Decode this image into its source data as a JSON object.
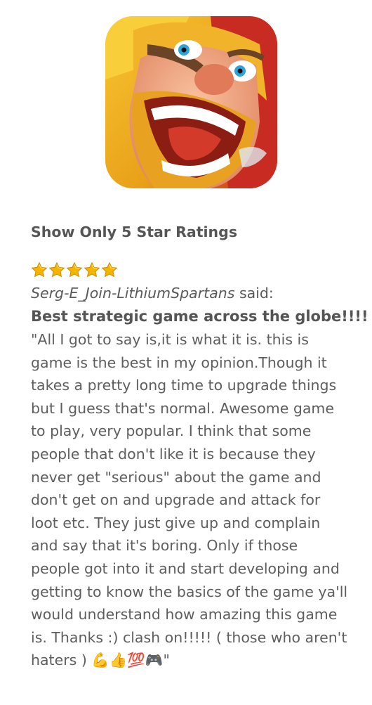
{
  "app": {
    "icon": "clash-of-clans-app-icon"
  },
  "filter": {
    "label": "Show Only 5 Star Ratings"
  },
  "review": {
    "rating": 5,
    "max_rating": 5,
    "author": "Serg-E_Join-LithiumSpartans",
    "said": " said:",
    "title": "Best strategic game across the globe!!!!",
    "body_lines": [
      "\"All I got to say is,it is what it is. this is",
      "game is the best in my opinion.Though it",
      "takes a pretty long time to upgrade things",
      "but I guess that's normal. Awesome game",
      "to play, very popular. I think that some",
      "people that don't like it is because they",
      "never get \"serious\" about the game and",
      "don't get on and upgrade and attack for",
      "loot etc. They just give up and complain",
      "and say that it's boring. Only if those",
      "people got into it and start developing and",
      "getting to know the basics of the game ya'll",
      "would understand how amazing this game",
      "is. Thanks :) clash on!!!!! ( those who aren't",
      "haters ) 💪👍💯🎮\""
    ]
  },
  "colors": {
    "star": "#f5b400",
    "text": "#5a5a5a"
  }
}
